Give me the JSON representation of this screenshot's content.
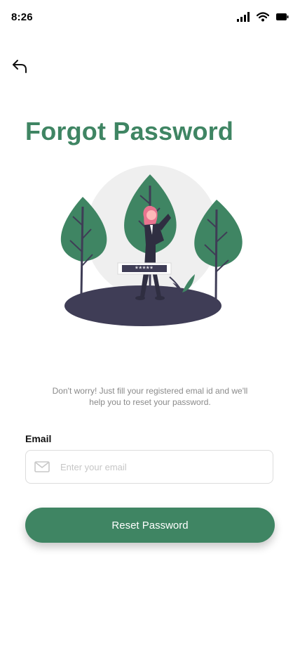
{
  "status_bar": {
    "time": "8:26",
    "icons": [
      "signal-icon",
      "wifi-icon",
      "battery-icon"
    ]
  },
  "header": {
    "back_icon": "back-arrow-icon"
  },
  "title": "Forgot Password",
  "subtitle": "Don't worry! Just fill your registered emal id and we'll help you to reset your password.",
  "illustration": {
    "password_mask": "*****"
  },
  "form": {
    "email_label": "Email",
    "email_placeholder": "Enter your email",
    "email_icon": "mail-icon"
  },
  "button": {
    "reset_label": "Reset Password"
  },
  "colors": {
    "brand": "#3f8563",
    "text": "#111111",
    "muted": "#8a8a8a"
  }
}
